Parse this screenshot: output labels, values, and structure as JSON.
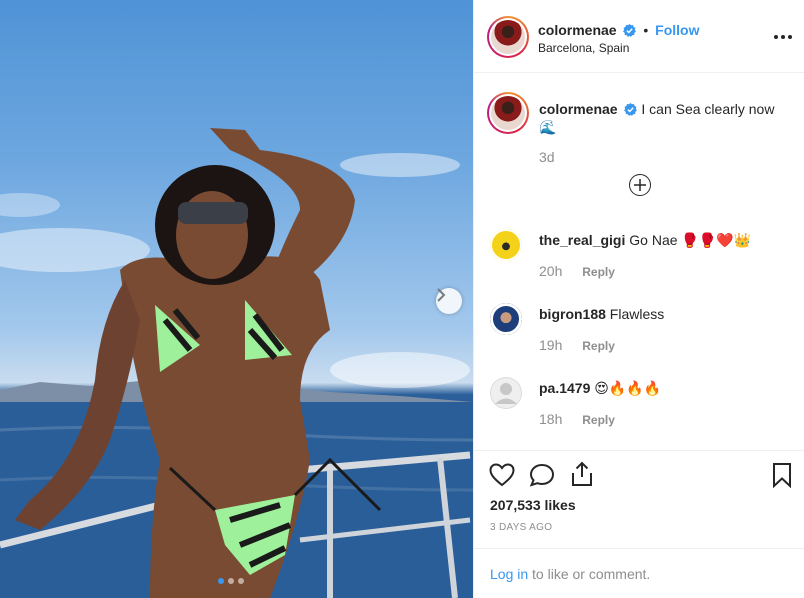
{
  "post": {
    "author": "colormenae",
    "follow_label": "Follow",
    "separator": "•",
    "location": "Barcelona, Spain",
    "caption": {
      "username": "colormenae",
      "text": "I can Sea clearly now",
      "emoji": "🌊",
      "age": "3d"
    },
    "carousel": {
      "total": 3,
      "active": 1
    }
  },
  "comments": [
    {
      "username": "the_real_gigi",
      "text": "Go Nae",
      "emoji": "🥊🥊❤️👑",
      "age": "20h",
      "reply_label": "Reply"
    },
    {
      "username": "bigron188",
      "text": "Flawless",
      "emoji": "",
      "age": "19h",
      "reply_label": "Reply"
    },
    {
      "username": "pa.1479",
      "text": "",
      "emoji": "😍🔥🔥🔥",
      "age": "18h",
      "reply_label": "Reply"
    }
  ],
  "engagement": {
    "likes": "207,533 likes",
    "timestamp": "3 DAYS AGO"
  },
  "login_prompt": {
    "link": "Log in",
    "rest": " to like or comment."
  },
  "icons": {
    "verified": "verified-badge-icon",
    "more": "more-options-icon",
    "load_more": "plus-circle-icon",
    "like": "heart-icon",
    "comment": "comment-icon",
    "share": "share-icon",
    "save": "bookmark-icon",
    "next": "chevron-right-icon"
  },
  "colors": {
    "link_blue": "#3897f0",
    "text": "#262626",
    "muted": "#8e8e8e",
    "border": "#efefef"
  }
}
